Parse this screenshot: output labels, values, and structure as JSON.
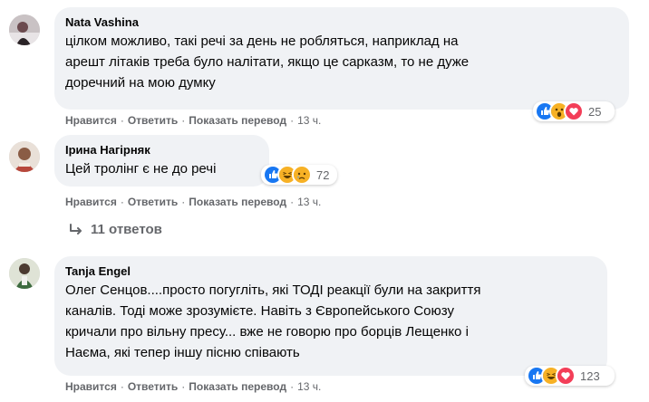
{
  "comments": [
    {
      "author": "Nata Vashina",
      "lines": [
        "цілком можливо, такі речі за день не робляться, наприклад на",
        "арешт літаків треба було налітати, якщо це сарказм, то не дуже",
        "доречний на мою думку"
      ],
      "actions": {
        "like": "Нравится",
        "reply": "Ответить",
        "translate": "Показать перевод",
        "time": "13 ч."
      },
      "reactions": {
        "icons": [
          "like-icon",
          "wow-icon",
          "love-icon"
        ],
        "count": "25"
      }
    },
    {
      "author": "Ірина Нагірняк",
      "lines": [
        "Цей тролінг є не до речі"
      ],
      "actions": {
        "like": "Нравится",
        "reply": "Ответить",
        "translate": "Показать перевод",
        "time": "13 ч."
      },
      "reactions": {
        "icons": [
          "like-icon",
          "haha-icon",
          "sad-icon"
        ],
        "count": "72"
      },
      "replies_label": "11 ответов"
    },
    {
      "author": "Tanja Engel",
      "lines": [
        "Олег Сенцов....просто погугліть, які ТОДІ реакції були на закриття",
        "каналів. Тоді може зрозумієте. Навіть з Європейського Союзу",
        "кричали про вільну пресу... вже не говорю про борців Лещенко і",
        "Наєма, які тепер іншу пісню співають"
      ],
      "actions": {
        "like": "Нравится",
        "reply": "Ответить",
        "translate": "Показать перевод",
        "time": "13 ч."
      },
      "reactions": {
        "icons": [
          "like-icon",
          "haha-icon",
          "love-icon"
        ],
        "count": "123"
      }
    }
  ],
  "colors": {
    "bubble": "#f0f2f5",
    "like": "#1877f2",
    "love": "#f33e58",
    "yellow": "#f7b125",
    "meta": "#65676b"
  }
}
